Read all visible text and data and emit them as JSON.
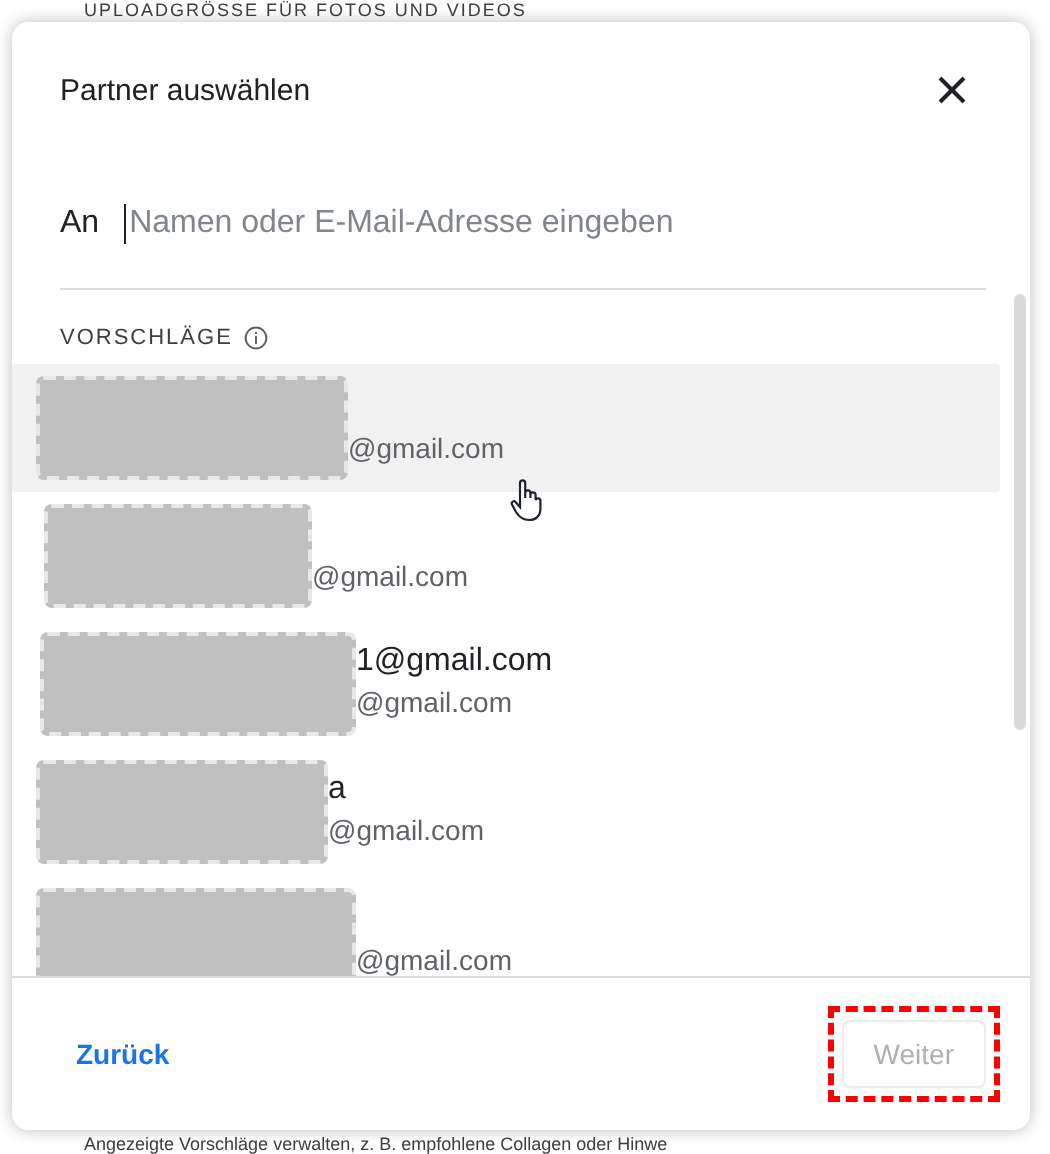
{
  "background": {
    "heading": "UPLOADGRÖSSE FÜR FOTOS UND VIDEOS",
    "footer_text": "Angezeigte Vorschläge verwalten, z. B. empfohlene Collagen oder Hinwe"
  },
  "dialog": {
    "title": "Partner auswählen",
    "to_label": "An",
    "search": {
      "placeholder": "Namen oder E-Mail-Adresse eingeben"
    },
    "suggestions_heading": "VORSCHLÄGE",
    "suggestions": [
      {
        "secondary": "@gmail.com",
        "selected": true
      },
      {
        "secondary": "@gmail.com",
        "selected": false
      },
      {
        "primary": "1@gmail.com",
        "secondary": "@gmail.com",
        "selected": false
      },
      {
        "primary": "a",
        "secondary": "@gmail.com",
        "selected": false
      },
      {
        "secondary": "@gmail.com",
        "selected": false
      }
    ],
    "back_button": "Zurück",
    "next_button": {
      "label": "Weiter",
      "disabled": true,
      "highlighted": true
    }
  }
}
